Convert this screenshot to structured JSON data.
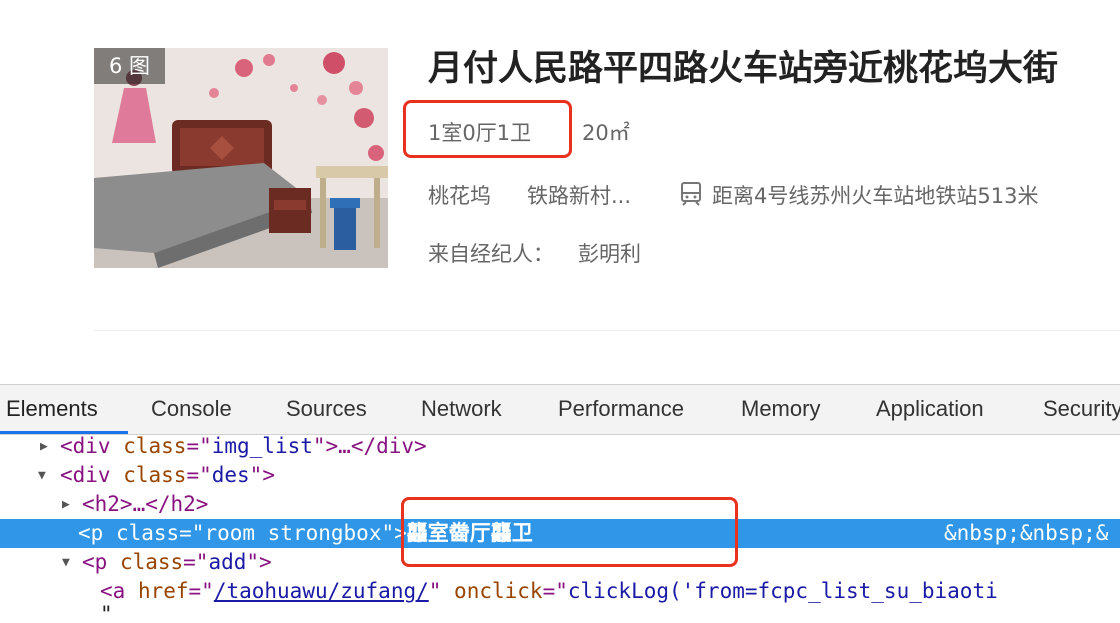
{
  "listing": {
    "image_count": "6 图",
    "title": "月付人民路平四路火车站旁近桃花坞大街",
    "room": "1室0厅1卫",
    "area": "20㎡",
    "location1": "桃花坞",
    "location2": "铁路新村...",
    "subway": "距离4号线苏州火车站地铁站513米",
    "agent_label": "来自经纪人：",
    "agent_name": "彭明利"
  },
  "devtools": {
    "tabs": [
      "Elements",
      "Console",
      "Sources",
      "Network",
      "Performance",
      "Memory",
      "Application",
      "Security"
    ],
    "active_tab": "Elements",
    "lines": {
      "l1": {
        "open": "<div ",
        "attr": "class",
        "eq": "=\"",
        "val": "img_list",
        "close": "\">…</div>"
      },
      "l2": {
        "open": "<div ",
        "attr": "class",
        "eq": "=\"",
        "val": "des",
        "close": "\">"
      },
      "l3": {
        "text": "<h2>…</h2>"
      },
      "l4": {
        "open": "<p ",
        "attr": "class",
        "eq": "=\"",
        "val": "room strongbox",
        "close": "\">",
        "content": "龘室齤厅龘卫",
        "tail": "&nbsp;&nbsp;&"
      },
      "l5": {
        "open": "<p ",
        "attr": "class",
        "eq": "=\"",
        "val": "add",
        "close": "\">"
      },
      "l6": {
        "open": "<a ",
        "attr": "href",
        "eq": "=\"",
        "val": "/taohuawu/zufang/",
        "mid": "\" ",
        "attr2": "onclick",
        "eq2": "=\"",
        "val2": "clickLog('from=fcpc_list_su_biaoti"
      },
      "l7": {
        "text": "\""
      }
    }
  }
}
